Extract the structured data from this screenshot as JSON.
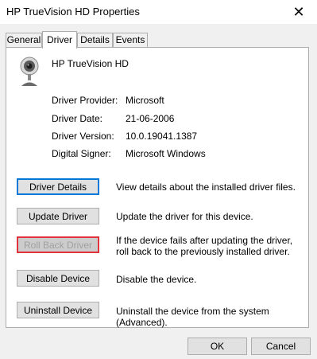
{
  "window": {
    "title": "HP TrueVision HD Properties",
    "close_glyph": "✕"
  },
  "tabs": [
    {
      "label": "General"
    },
    {
      "label": "Driver"
    },
    {
      "label": "Details"
    },
    {
      "label": "Events"
    }
  ],
  "active_tab": "Driver",
  "device": {
    "name": "HP TrueVision HD",
    "icon": "webcam-icon"
  },
  "info": [
    {
      "label": "Driver Provider:",
      "value": "Microsoft"
    },
    {
      "label": "Driver Date:",
      "value": "21-06-2006"
    },
    {
      "label": "Driver Version:",
      "value": "10.0.19041.1387"
    },
    {
      "label": "Digital Signer:",
      "value": "Microsoft Windows"
    }
  ],
  "actions": [
    {
      "label": "Driver Details",
      "description": "View details about the installed driver files.",
      "state": "focused"
    },
    {
      "label": "Update Driver",
      "description": "Update the driver for this device.",
      "state": "normal"
    },
    {
      "label": "Roll Back Driver",
      "description": "If the device fails after updating the driver, roll back to the previously installed driver.",
      "state": "disabled-highlighted"
    },
    {
      "label": "Disable Device",
      "description": "Disable the device.",
      "state": "normal"
    },
    {
      "label": "Uninstall Device",
      "description": "Uninstall the device from the system (Advanced).",
      "state": "normal"
    }
  ],
  "footer": {
    "ok_label": "OK",
    "cancel_label": "Cancel"
  },
  "colors": {
    "focus_border": "#0078d7",
    "highlight_border": "#e0333b",
    "dialog_bg": "#f0f0f0"
  }
}
